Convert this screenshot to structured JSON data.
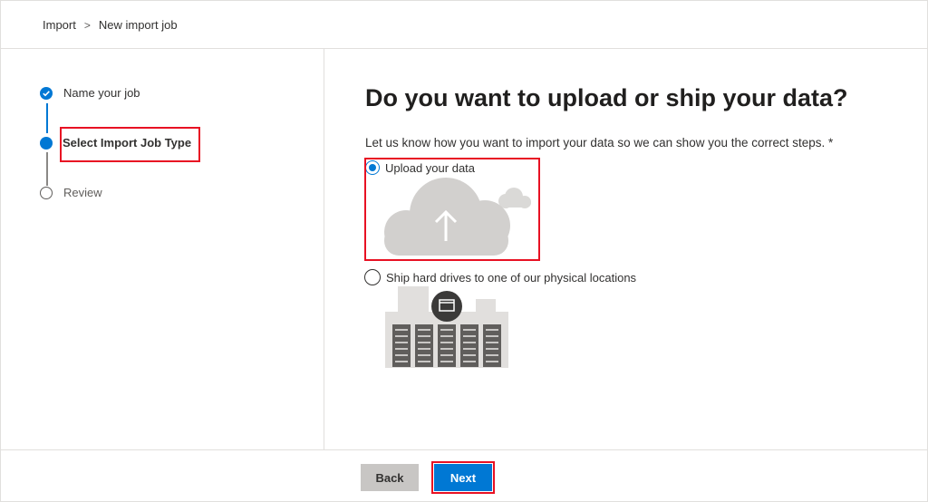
{
  "breadcrumb": {
    "items": [
      "Import",
      "New import job"
    ],
    "separator": ">"
  },
  "steps": [
    {
      "label": "Name your job",
      "state": "done"
    },
    {
      "label": "Select Import Job Type",
      "state": "current"
    },
    {
      "label": "Review",
      "state": "todo"
    }
  ],
  "main": {
    "title": "Do you want to upload or ship your data?",
    "description": "Let us know how you want to import your data so we can show you the correct steps. *",
    "options": [
      {
        "label": "Upload your data",
        "selected": true,
        "icon": "cloud-upload-icon"
      },
      {
        "label": "Ship hard drives to one of our physical locations",
        "selected": false,
        "icon": "datacenter-icon"
      }
    ]
  },
  "footer": {
    "back_label": "Back",
    "next_label": "Next"
  },
  "colors": {
    "accent": "#0078d4",
    "highlight": "#e81123",
    "button_disabled": "#c8c6c4"
  }
}
